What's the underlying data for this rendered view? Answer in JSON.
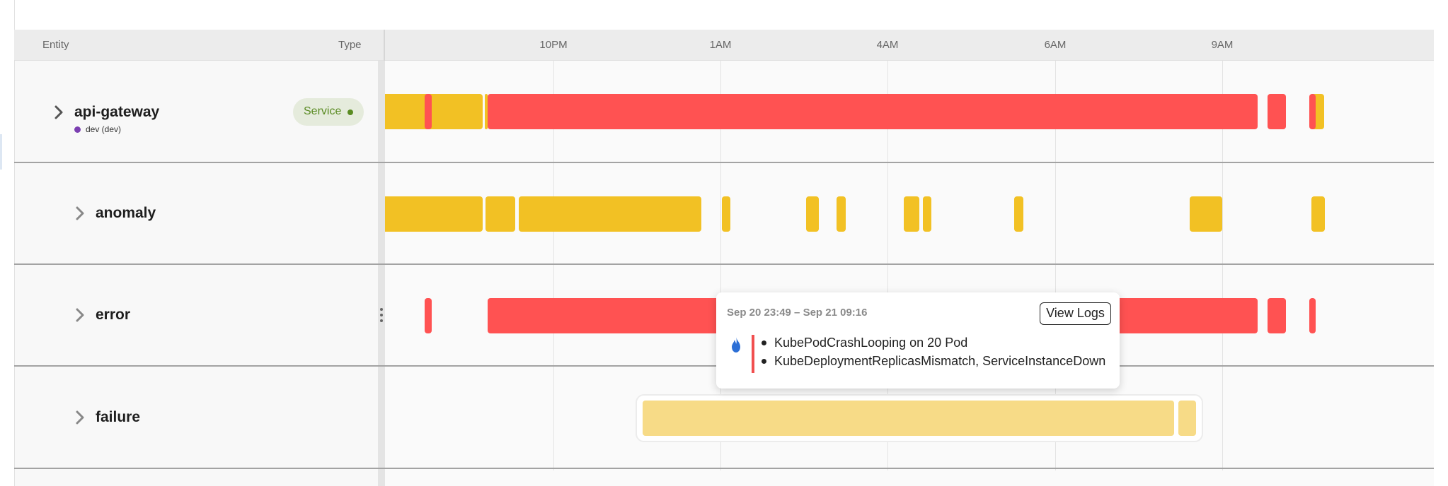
{
  "header": {
    "entity_label": "Entity",
    "type_label": "Type",
    "ticks": [
      "10PM",
      "1AM",
      "4AM",
      "6AM",
      "9AM"
    ]
  },
  "rows": [
    {
      "label": "api-gateway",
      "environment": "dev (dev)",
      "type_badge": "Service"
    },
    {
      "label": "anomaly"
    },
    {
      "label": "error"
    },
    {
      "label": "failure"
    }
  ],
  "colors": {
    "error": "#ff5252",
    "anomaly": "#f2c124",
    "failure": "#f7db87",
    "service_badge_bg": "#e5ebdc",
    "service_badge_text": "#5a8b22",
    "env_dot": "#7b3fb1"
  },
  "tooltip": {
    "time_range": "Sep 20 23:49 – Sep 21 09:16",
    "button_label": "View Logs",
    "icon": "flame-icon",
    "items": [
      "KubePodCrashLooping on 20 Pod",
      "KubeDeploymentReplicasMismatch, ServiceInstanceDown"
    ]
  }
}
